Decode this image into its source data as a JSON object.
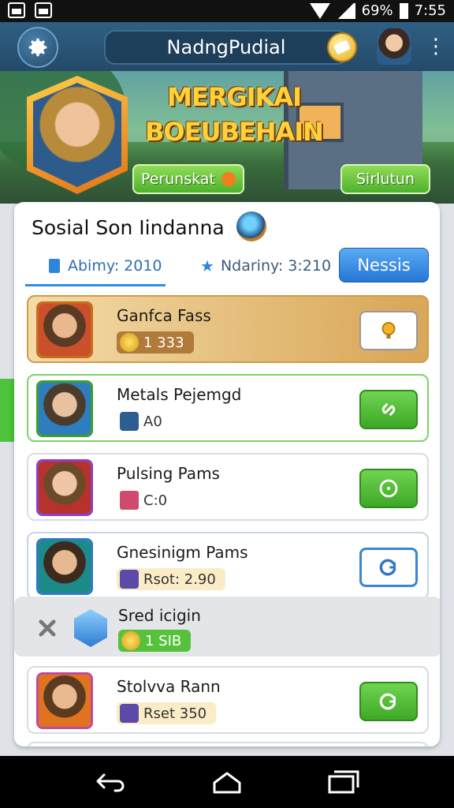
{
  "status_bar": {
    "battery": "69%",
    "time": "7:55"
  },
  "app_bar": {
    "title": "NadngPudial"
  },
  "banner": {
    "title_line1": "MERGIKAI",
    "title_line2": "BOEUBEHAIN",
    "left_button": "Perunskat",
    "right_button": "Sirlutun"
  },
  "panel": {
    "title": "Sosial Son Iindanna",
    "tabs": [
      {
        "label": "Abimy: 2010"
      },
      {
        "label": "Ndariny: 3:210"
      }
    ],
    "tab_button": "Nessis",
    "rows": [
      {
        "name": "Ganfca Fass",
        "value": "1 333"
      },
      {
        "name": "Metals Pejemgd",
        "value": "A0"
      },
      {
        "name": "Pulsing Pams",
        "value": "C:0"
      },
      {
        "name": "Gnesinigm Pams",
        "value": "Rsot: 2.90"
      },
      {
        "name": "Sred icigin",
        "value": "1 SIB"
      },
      {
        "name": "Stolvva Rann",
        "value": "Rset 350"
      }
    ]
  },
  "colors": {
    "accent_blue": "#2f86d9",
    "green": "#4fb12d",
    "gold": "#d9a85a",
    "appbar": "#2f5f83"
  }
}
